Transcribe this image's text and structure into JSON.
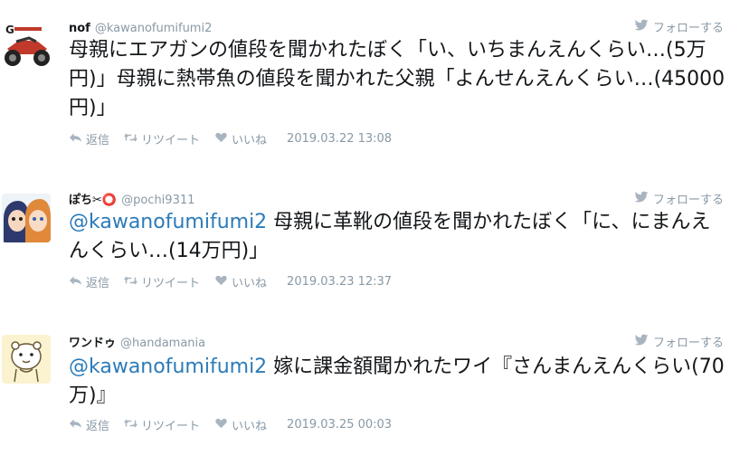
{
  "follow_label": "フォローする",
  "reply_label": "返信",
  "retweet_label": "リツイート",
  "like_label": "いいね",
  "tweets": [
    {
      "name": "nof",
      "handle": "@kawanofumifumi2",
      "text": "母親にエアガンの値段を聞かれたぼく「い、いちまんえんくらい…(5万円)」母親に熱帯魚の値段を聞かれた父親「よんせんえんくらい…(45000円)」",
      "timestamp": "2019.03.22 13:08"
    },
    {
      "name": "ぽち✂⭕",
      "handle": "@pochi9311",
      "mention": "@kawanofumifumi2",
      "text": " 母親に革靴の値段を聞かれたぼく「に、にまんえんくらい…(14万円)」",
      "timestamp": "2019.03.23 12:37"
    },
    {
      "name": "ワンドゥ",
      "handle": "@handamania",
      "mention": "@kawanofumifumi2",
      "text": " 嫁に課金額聞かれたワイ『さんまんえんくらい(70万)』",
      "timestamp": "2019.03.25 00:03"
    }
  ]
}
